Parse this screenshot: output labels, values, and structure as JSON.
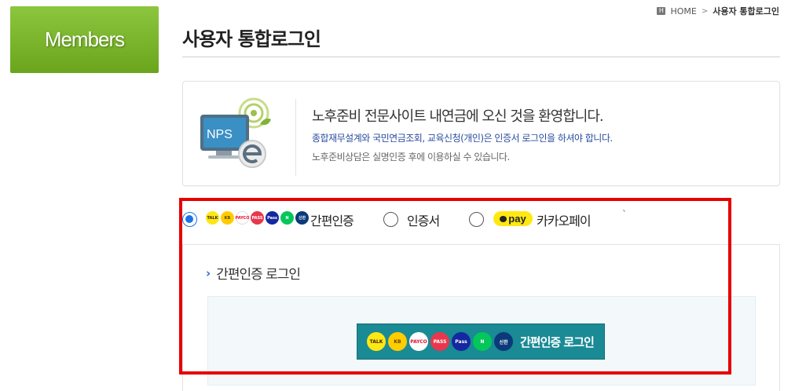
{
  "sidebar": {
    "badge": "Members"
  },
  "breadcrumb": {
    "home_icon": "H",
    "home": "HOME",
    "separator": ">",
    "current": "사용자 통합로그인"
  },
  "header": {
    "title": "사용자 통합로그인"
  },
  "welcome": {
    "logo_text": "NPS",
    "heading": "노후준비 전문사이트 내연금에 오신 것을 환영합니다.",
    "notice": "종합재무설계와 국민연금조회, 교육신청(개인)은 인증서 로그인을 하셔야 합니다.",
    "sub": "노후준비상담은 실명인증 후에 이용하실 수 있습니다."
  },
  "methods": {
    "simple_label": "간편인증",
    "cert_label": "인증서",
    "kakao_label": "카카오페이",
    "kakao_icon_text": "pay",
    "selected": "간편인증",
    "tick": "`",
    "mini_icons": [
      {
        "name": "kakao-talk-icon",
        "text": "TALK",
        "bg": "#ffe812",
        "fg": "#3a1d1d"
      },
      {
        "name": "kb-icon",
        "text": "KB",
        "bg": "#ffcc00",
        "fg": "#5a4a00"
      },
      {
        "name": "payco-icon",
        "text": "PAYCO",
        "bg": "#ffffff",
        "fg": "#e8112d"
      },
      {
        "name": "pass-icon",
        "text": "PASS",
        "bg": "#e8374c",
        "fg": "#ffffff"
      },
      {
        "name": "samsung-pass-icon",
        "text": "Pass",
        "bg": "#1428a0",
        "fg": "#ffffff"
      },
      {
        "name": "naver-icon",
        "text": "N",
        "bg": "#03c75a",
        "fg": "#ffffff"
      },
      {
        "name": "shinhan-icon",
        "text": "신한",
        "bg": "#0a3a7a",
        "fg": "#ffffff"
      }
    ]
  },
  "panel": {
    "heading": "간편인증 로그인",
    "button_label": "간편인증 로그인"
  },
  "colors": {
    "accent_green": "#7ab929",
    "button_teal": "#1a8a95",
    "highlight_red": "#e60000",
    "link_blue": "#2b4d9e"
  }
}
